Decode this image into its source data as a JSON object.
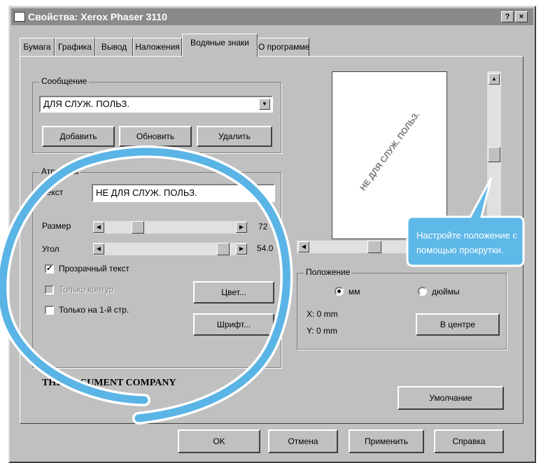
{
  "window": {
    "title": "Свойства: Xerox Phaser 3110",
    "help_label": "?",
    "close_label": "×"
  },
  "tabs": [
    {
      "label": "Бумага"
    },
    {
      "label": "Графика"
    },
    {
      "label": "Вывод"
    },
    {
      "label": "Наложения"
    },
    {
      "label": "Водяные знаки"
    },
    {
      "label": "О программе"
    }
  ],
  "message": {
    "group_label": "Сообщение",
    "selected": "ДЛЯ СЛУЖ. ПОЛЬЗ.",
    "add_label": "Добавить",
    "update_label": "Обновить",
    "delete_label": "Удалить"
  },
  "attributes": {
    "group_label": "Атрибуты",
    "text_label": "Текст",
    "text_value": "НЕ ДЛЯ СЛУЖ. ПОЛЬЗ.",
    "size_label": "Размер",
    "size_value": "72",
    "angle_label": "Угол",
    "angle_value": "54.0",
    "transparent_label": "Прозрачный текст",
    "transparent_checked": true,
    "outline_label": "Только контур",
    "outline_checked": false,
    "first_page_label": "Только на 1-й стр.",
    "first_page_checked": false,
    "color_label": "Цвет...",
    "font_label": "Шрифт..."
  },
  "preview": {
    "watermark_text": "НЕ ДЛЯ СЛУЖ. ПОЛЬЗ."
  },
  "position": {
    "group_label": "Положение",
    "mm_label": "мм",
    "inch_label": "дюймы",
    "unit_selected": "mm",
    "x_label": "X: 0 mm",
    "y_label": "Y: 0 mm",
    "center_label": "В центре"
  },
  "callout": {
    "text": "Настройте положение с помощью прокрутки."
  },
  "logo": {
    "text": "THE DOCUMENT COMPANY"
  },
  "default_label": "Умолчание",
  "footer": {
    "ok_label": "OK",
    "cancel_label": "Отмена",
    "apply_label": "Применить",
    "help_label": "Справка"
  },
  "colors": {
    "titlebar": "#8a8a8a",
    "dialog": "#c0c0c0",
    "callout": "#5eb8e8",
    "highlight": "#5ab4e6"
  }
}
